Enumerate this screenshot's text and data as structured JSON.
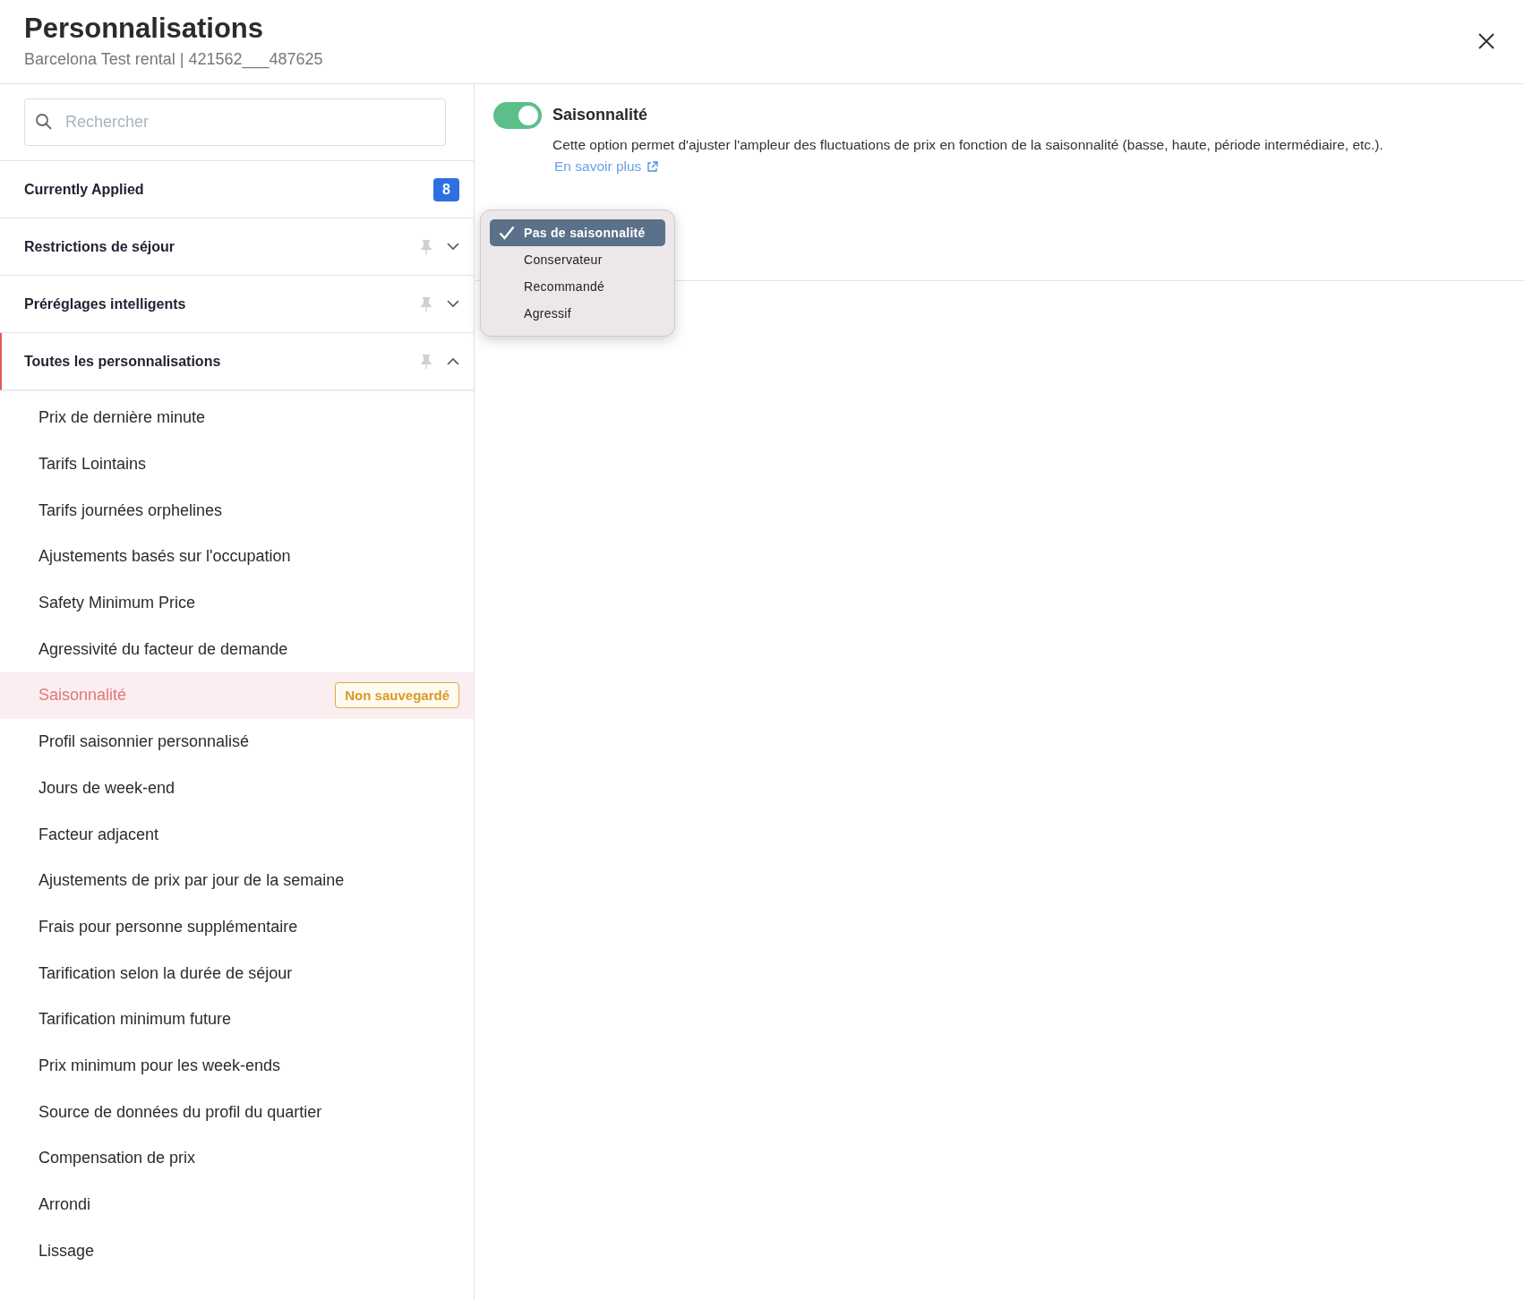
{
  "header": {
    "title": "Personnalisations",
    "subtitle": "Barcelona Test rental | 421562___487625"
  },
  "search": {
    "placeholder": "Rechercher"
  },
  "sections": [
    {
      "kind": "count",
      "label": "Currently Applied",
      "count": "8",
      "selected": false
    },
    {
      "kind": "group",
      "label": "Restrictions de séjour",
      "expanded": false,
      "selected": false
    },
    {
      "kind": "group",
      "label": "Préréglages intelligents",
      "expanded": false,
      "selected": false
    },
    {
      "kind": "group",
      "label": "Toutes les personnalisations",
      "expanded": true,
      "selected": true,
      "items": [
        {
          "label": "Prix de dernière minute",
          "selected": false
        },
        {
          "label": "Tarifs Lointains",
          "selected": false
        },
        {
          "label": "Tarifs journées orphelines",
          "selected": false
        },
        {
          "label": "Ajustements basés sur l'occupation",
          "selected": false
        },
        {
          "label": "Safety Minimum Price",
          "selected": false
        },
        {
          "label": "Agressivité du facteur de demande",
          "selected": false
        },
        {
          "label": "Saisonnalité",
          "selected": true,
          "badge": "Non sauvegardé"
        },
        {
          "label": "Profil saisonnier personnalisé",
          "selected": false
        },
        {
          "label": "Jours de week-end",
          "selected": false
        },
        {
          "label": "Facteur adjacent",
          "selected": false
        },
        {
          "label": "Ajustements de prix par jour de la semaine",
          "selected": false
        },
        {
          "label": "Frais pour personne supplémentaire",
          "selected": false
        },
        {
          "label": "Tarification selon la durée de séjour",
          "selected": false
        },
        {
          "label": "Tarification minimum future",
          "selected": false
        },
        {
          "label": "Prix minimum pour les week-ends",
          "selected": false
        },
        {
          "label": "Source de données du profil du quartier",
          "selected": false
        },
        {
          "label": "Compensation de prix",
          "selected": false
        },
        {
          "label": "Arrondi",
          "selected": false
        },
        {
          "label": "Lissage",
          "selected": false
        }
      ]
    }
  ],
  "setting": {
    "title": "Saisonnalité",
    "on": true,
    "description": "Cette option permet d'ajuster l'ampleur des fluctuations de prix en fonction de la saisonnalité (basse, haute, période intermédiaire, etc.).",
    "link": "En savoir plus"
  },
  "dropdown_menu": {
    "options": [
      {
        "label": "Pas de saisonnalité",
        "selected": true
      },
      {
        "label": "Conservateur",
        "selected": false
      },
      {
        "label": "Recommandé",
        "selected": false
      },
      {
        "label": "Agressif",
        "selected": false
      }
    ]
  }
}
